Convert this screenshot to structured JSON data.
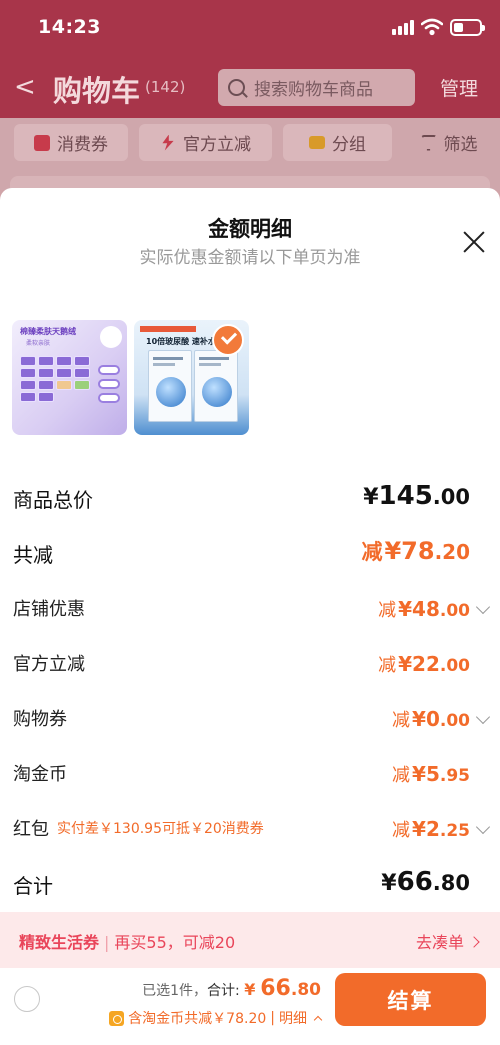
{
  "status": {
    "time": "14:23"
  },
  "nav": {
    "title": "购物车",
    "count": "(142)",
    "search_placeholder": "搜索购物车商品",
    "manage": "管理"
  },
  "chips": [
    {
      "label": "消费券",
      "color": "#c73b4b"
    },
    {
      "label": "官方立减",
      "color": "#c73b4b"
    },
    {
      "label": "分组",
      "color": "#d89a2a"
    },
    {
      "label": "筛选",
      "color": "#6d4a50"
    }
  ],
  "sheet": {
    "title": "金额明细",
    "subtitle": "实际优惠金额请以下单页为准"
  },
  "products": [
    {
      "name": "tissue-pack",
      "head": "棉臻柔肤天鹅绒",
      "head2": "柔软亲肤",
      "selected": false
    },
    {
      "name": "hyaluronic-mask",
      "head": "10倍玻尿酸 速补水",
      "selected": true
    }
  ],
  "rows": {
    "total_price": {
      "label": "商品总价",
      "currency": "¥",
      "int": "145",
      "dec": ".00"
    },
    "total_discount": {
      "label": "共减",
      "prefix": "减",
      "currency": "¥",
      "int": "78",
      "dec": ".20"
    },
    "store": {
      "label": "店铺优惠",
      "prefix": "减",
      "currency": "¥",
      "int": "48",
      "dec": ".00"
    },
    "official": {
      "label": "官方立减",
      "prefix": "减",
      "currency": "¥",
      "int": "22",
      "dec": ".00"
    },
    "coupon": {
      "label": "购物券",
      "prefix": "减",
      "currency": "¥",
      "int": "0",
      "dec": ".00"
    },
    "gold": {
      "label": "淘金币",
      "prefix": "减",
      "currency": "¥",
      "int": "5",
      "dec": ".95"
    },
    "hongbao": {
      "label": "红包",
      "note": "实付差￥130.95可抵￥20消费券",
      "prefix": "减",
      "currency": "¥",
      "int": "2",
      "dec": ".25"
    },
    "grand": {
      "label": "合计",
      "currency": "¥",
      "int": "66",
      "dec": ".80"
    }
  },
  "banner": {
    "name": "精致生活券",
    "text": "再买55，可减20",
    "action": "去凑单"
  },
  "bottom": {
    "selected": "已选1件，",
    "total_label": "合计:",
    "currency": "¥",
    "int": "66",
    "dec": ".80",
    "gold_text": "含淘金币共减￥78.20",
    "sep": "|",
    "detail": "明细",
    "checkout": "结算"
  },
  "colors": {
    "accent": "#f26b2a",
    "banner_text": "#e9455a",
    "banner_bg": "#fde9ea",
    "nav_bg": "#a8354a"
  }
}
